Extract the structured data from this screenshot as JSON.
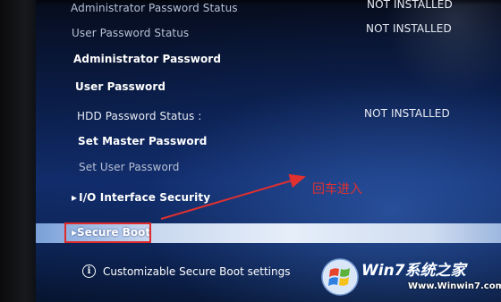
{
  "settings": {
    "admin_password_status": {
      "label": "Administrator Password Status",
      "value": "NOT INSTALLED"
    },
    "user_password_status": {
      "label": "User Password Status",
      "value": "NOT INSTALLED"
    },
    "admin_password": {
      "label": "Administrator Password"
    },
    "user_password": {
      "label": "User Password"
    },
    "hdd_password_status": {
      "label": "HDD Password Status  :",
      "value": "NOT INSTALLED"
    },
    "set_master_password": {
      "label": "Set Master Password"
    },
    "set_user_password": {
      "label": "Set User Password"
    },
    "io_interface_security": {
      "label": "I/O Interface Security",
      "arrow": "▸"
    },
    "secure_boot": {
      "label": "Secure Boot",
      "arrow": "▸"
    }
  },
  "help": {
    "icon": "info-icon",
    "text": "Customizable Secure Boot settings"
  },
  "annotation": {
    "text": "回车进入",
    "color": "#e03030"
  },
  "watermark": {
    "title": "Win7系统之家",
    "url": "Www.Winwin7.com"
  },
  "colors": {
    "selection": "#e6eef9",
    "highlight_box": "#e02a2a",
    "background": "#112c6a"
  }
}
